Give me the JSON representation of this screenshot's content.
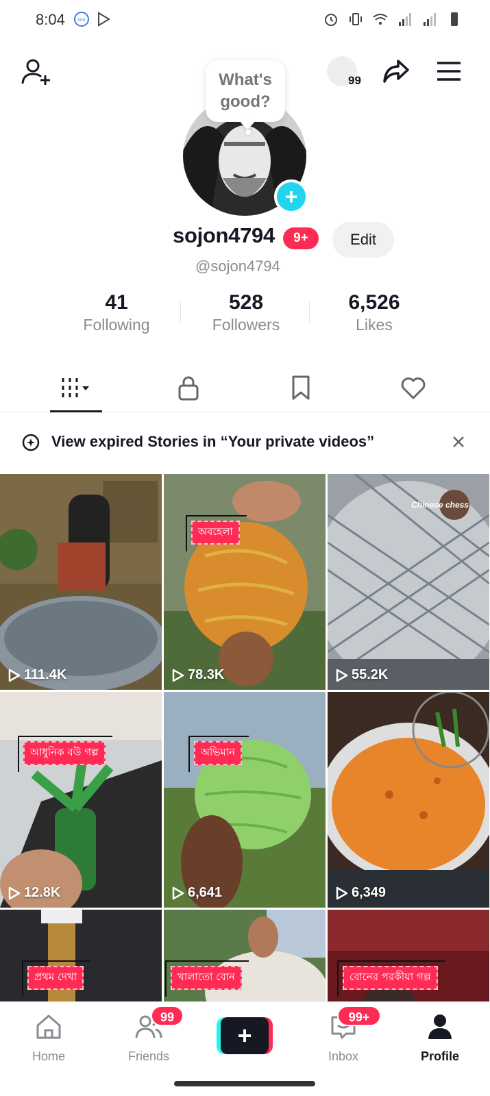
{
  "status_bar": {
    "time": "8:04",
    "left_icons": [
      "imo-icon",
      "play-store-icon"
    ],
    "right_icons": [
      "alarm-icon",
      "vibrate-icon",
      "wifi-icon",
      "signal-icon",
      "signal-icon",
      "battery-icon"
    ]
  },
  "header": {
    "notification_count": "99"
  },
  "profile": {
    "bubble_text": "What's good?",
    "username": "sojon4794",
    "badge": "9+",
    "edit_label": "Edit",
    "handle": "@sojon4794"
  },
  "stats": [
    {
      "value": "41",
      "label": "Following"
    },
    {
      "value": "528",
      "label": "Followers"
    },
    {
      "value": "6,526",
      "label": "Likes"
    }
  ],
  "tabs": [
    {
      "name": "videos",
      "icon": "grid-icon"
    },
    {
      "name": "private",
      "icon": "lock-icon"
    },
    {
      "name": "favorites",
      "icon": "bookmark-icon"
    },
    {
      "name": "liked",
      "icon": "heart-icon"
    }
  ],
  "banner": {
    "text": "View expired Stories in “Your private videos”"
  },
  "videos": [
    {
      "views": "111.4K",
      "caption": ""
    },
    {
      "views": "78.3K",
      "caption": "অবহেলা"
    },
    {
      "views": "55.2K",
      "caption": "Chinese chess"
    },
    {
      "views": "12.8K",
      "caption": "আধুনিক বউ গল্প"
    },
    {
      "views": "6,641",
      "caption": "অভিমান"
    },
    {
      "views": "6,349",
      "caption": ""
    },
    {
      "views": "",
      "caption": "প্রথম দেখা"
    },
    {
      "views": "",
      "caption": "খালাতো বোন"
    },
    {
      "views": "",
      "caption": "বোনের পরকীয়া গল্প"
    }
  ],
  "bottom_nav": {
    "home": "Home",
    "friends": "Friends",
    "friends_badge": "99",
    "inbox": "Inbox",
    "inbox_badge": "99+",
    "profile": "Profile"
  },
  "colors": {
    "accent": "#fe2c55",
    "cyan": "#25f4ee",
    "text_primary": "#161823",
    "text_secondary": "#8a8b91"
  }
}
